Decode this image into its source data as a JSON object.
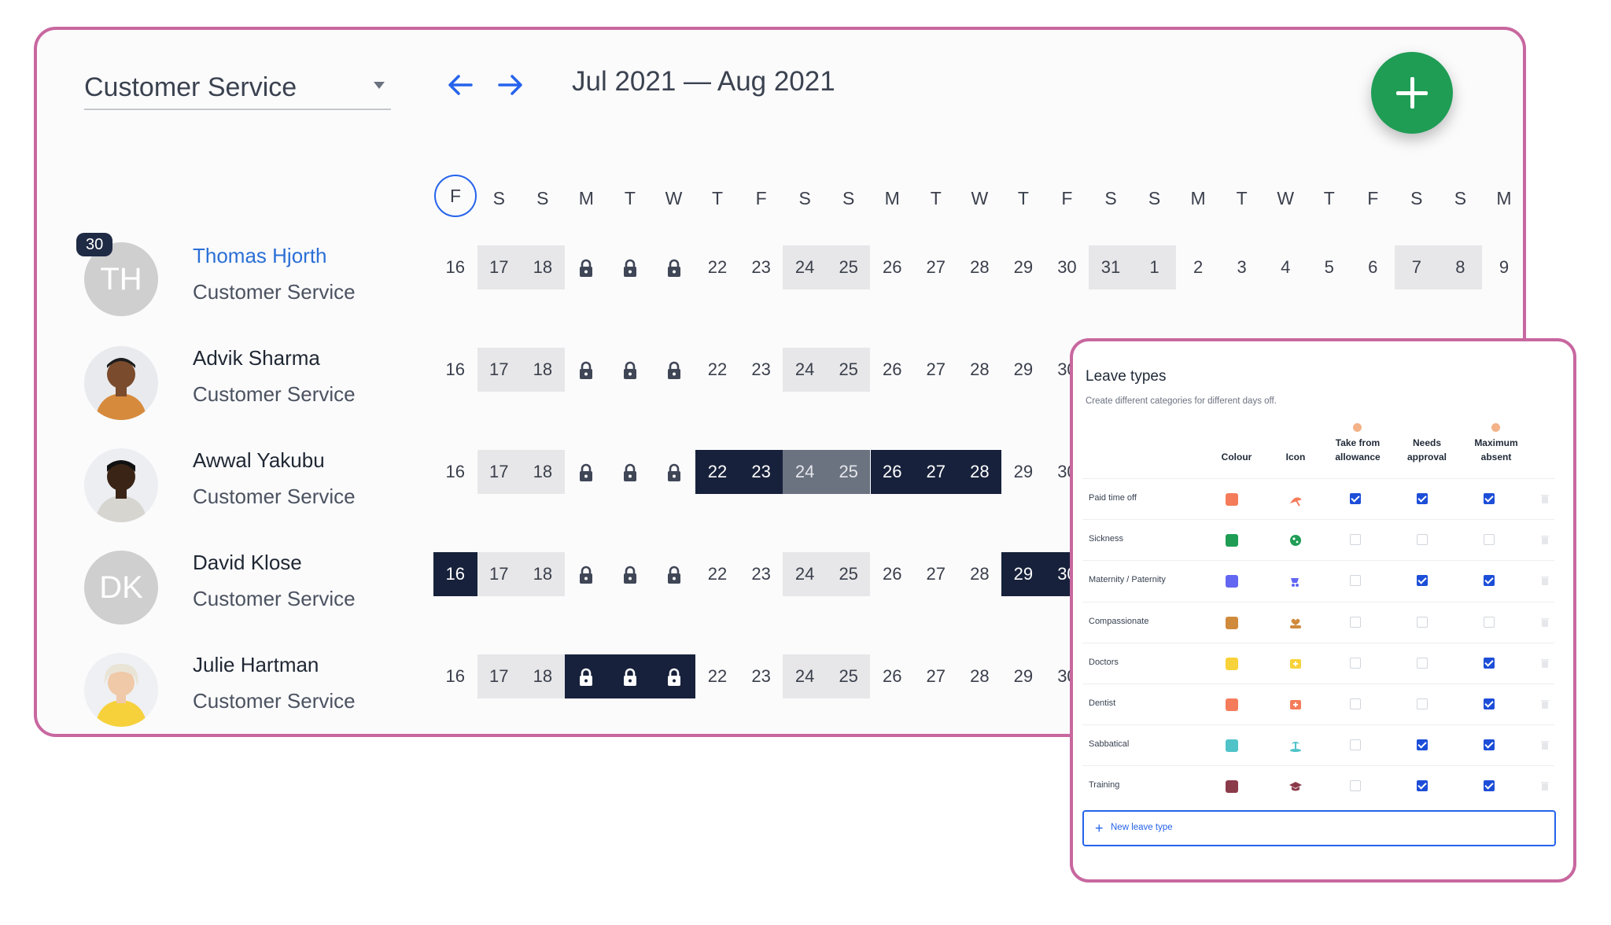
{
  "team_select": {
    "value": "Customer Service"
  },
  "range_label": "Jul 2021 — Aug 2021",
  "day_headers": [
    "F",
    "S",
    "S",
    "M",
    "T",
    "W",
    "T",
    "F",
    "S",
    "S",
    "M",
    "T",
    "W",
    "T",
    "F",
    "S",
    "S",
    "M",
    "T",
    "W",
    "T",
    "F",
    "S",
    "S",
    "M"
  ],
  "today_letter": "F",
  "dates": [
    "16",
    "17",
    "18",
    "",
    "",
    "",
    "22",
    "23",
    "24",
    "25",
    "26",
    "27",
    "28",
    "29",
    "30",
    "31",
    "1",
    "2",
    "3",
    "4",
    "5",
    "6",
    "7",
    "8",
    "9"
  ],
  "badge": "30",
  "employees": [
    {
      "name": "Thomas Hjorth",
      "team": "Customer Service",
      "initials": "TH"
    },
    {
      "name": "Advik Sharma",
      "team": "Customer Service"
    },
    {
      "name": "Awwal Yakubu",
      "team": "Customer Service"
    },
    {
      "name": "David Klose",
      "team": "Customer Service",
      "initials": "DK"
    },
    {
      "name": "Julie Hartman",
      "team": "Customer Service"
    }
  ],
  "leave_types": {
    "title": "Leave types",
    "subtitle": "Create different categories for different days off.",
    "headers": {
      "colour": "Colour",
      "icon": "Icon",
      "allowance": "Take from allowance",
      "approval": "Needs approval",
      "absent": "Maximum absent"
    },
    "rows": [
      {
        "name": "Paid time off",
        "color": "#f47c5a",
        "icon": "beach-umbrella-icon",
        "allowance": true,
        "approval": true,
        "absent": true
      },
      {
        "name": "Sickness",
        "color": "#1f9d55",
        "icon": "virus-icon",
        "allowance": false,
        "approval": false,
        "absent": false
      },
      {
        "name": "Maternity / Paternity",
        "color": "#6366f1",
        "icon": "stroller-icon",
        "allowance": false,
        "approval": true,
        "absent": true
      },
      {
        "name": "Compassionate",
        "color": "#d08a3c",
        "icon": "heart-hand-icon",
        "allowance": false,
        "approval": false,
        "absent": false
      },
      {
        "name": "Doctors",
        "color": "#f8d23a",
        "icon": "medical-kit-icon",
        "allowance": false,
        "approval": false,
        "absent": true
      },
      {
        "name": "Dentist",
        "color": "#f47c5a",
        "icon": "first-aid-icon",
        "allowance": false,
        "approval": false,
        "absent": true
      },
      {
        "name": "Sabbatical",
        "color": "#4fc3c8",
        "icon": "island-icon",
        "allowance": false,
        "approval": true,
        "absent": true
      },
      {
        "name": "Training",
        "color": "#8b3a4a",
        "icon": "graduation-cap-icon",
        "allowance": false,
        "approval": true,
        "absent": true
      }
    ],
    "new_button": "New leave type"
  }
}
